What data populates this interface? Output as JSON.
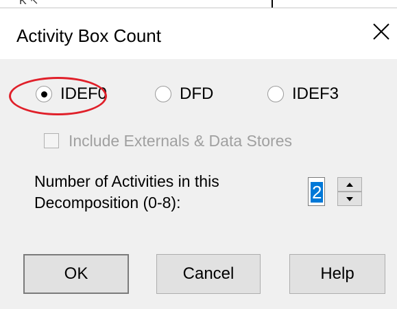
{
  "background_window": {
    "partial_text": "K̆ ↖"
  },
  "dialog": {
    "title": "Activity Box Count",
    "close_glyph": "×"
  },
  "model_type": {
    "options": [
      {
        "label": "IDEF0",
        "selected": true
      },
      {
        "label": "DFD",
        "selected": false
      },
      {
        "label": "IDEF3",
        "selected": false
      }
    ],
    "highlight_color": "#e0202a"
  },
  "include_externals": {
    "label": "Include Externals & Data Stores",
    "checked": false,
    "enabled": false
  },
  "activity_count": {
    "label_line1": "Number of Activities in this",
    "label_line2": "Decomposition (0-8):",
    "value": "2"
  },
  "buttons": {
    "ok": "OK",
    "cancel": "Cancel",
    "help": "Help"
  },
  "colors": {
    "selection": "#0078d7",
    "dialog_bg": "#f0f0f0",
    "title_bg": "#ffffff"
  }
}
